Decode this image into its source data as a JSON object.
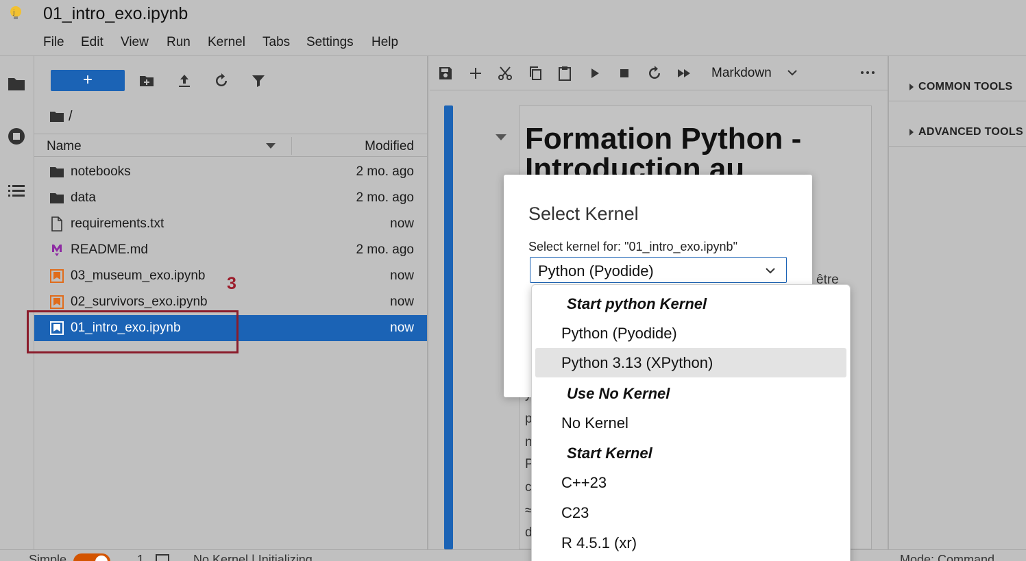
{
  "window": {
    "title": "01_intro_exo.ipynb"
  },
  "menu": [
    "File",
    "Edit",
    "View",
    "Run",
    "Kernel",
    "Tabs",
    "Settings",
    "Help"
  ],
  "filebrowser": {
    "new_label": "+",
    "breadcrumb": "/",
    "columns": {
      "name": "Name",
      "modified": "Modified"
    },
    "files": [
      {
        "name": "notebooks",
        "modified": "2 mo. ago",
        "type": "folder"
      },
      {
        "name": "data",
        "modified": "2 mo. ago",
        "type": "folder"
      },
      {
        "name": "requirements.txt",
        "modified": "now",
        "type": "file"
      },
      {
        "name": "README.md",
        "modified": "2 mo. ago",
        "type": "markdown"
      },
      {
        "name": "03_museum_exo.ipynb",
        "modified": "now",
        "type": "notebook"
      },
      {
        "name": "02_survivors_exo.ipynb",
        "modified": "now",
        "type": "notebook"
      },
      {
        "name": "01_intro_exo.ipynb",
        "modified": "now",
        "type": "notebook",
        "selected": true
      }
    ],
    "annotation": "3"
  },
  "notebook": {
    "cell_type": "Markdown",
    "heading_line1": "Formation Python -",
    "heading_line2": "Introduction au",
    "fragment_right": "être",
    "fragment_letters": [
      "y",
      "p",
      "n",
      "P",
      "c",
      "≈",
      "d"
    ]
  },
  "rightpanel": {
    "sections": [
      "COMMON TOOLS",
      "ADVANCED TOOLS"
    ]
  },
  "statusbar": {
    "mode_label": "Simple",
    "count": "1",
    "kernel_status": "No Kernel | Initializing",
    "mode": "Mode: Command"
  },
  "dialog": {
    "title": "Select Kernel",
    "label": "Select kernel for: \"01_intro_exo.ipynb\"",
    "selected_value": "Python (Pyodide)"
  },
  "dropdown": {
    "groups": [
      {
        "label": "Start python Kernel",
        "options": [
          "Python (Pyodide)",
          "Python 3.13 (XPython)"
        ]
      },
      {
        "label": "Use No Kernel",
        "options": [
          "No Kernel"
        ]
      },
      {
        "label": "Start Kernel",
        "options": [
          "C++23",
          "C23",
          "R 4.5.1 (xr)"
        ]
      }
    ],
    "hovered": "Python 3.13 (XPython)"
  },
  "colors": {
    "accent": "#1b63b5",
    "annotation": "#8a1c2b",
    "notebook_icon": "#e06c1b",
    "markdown_icon": "#8e2aa3"
  }
}
